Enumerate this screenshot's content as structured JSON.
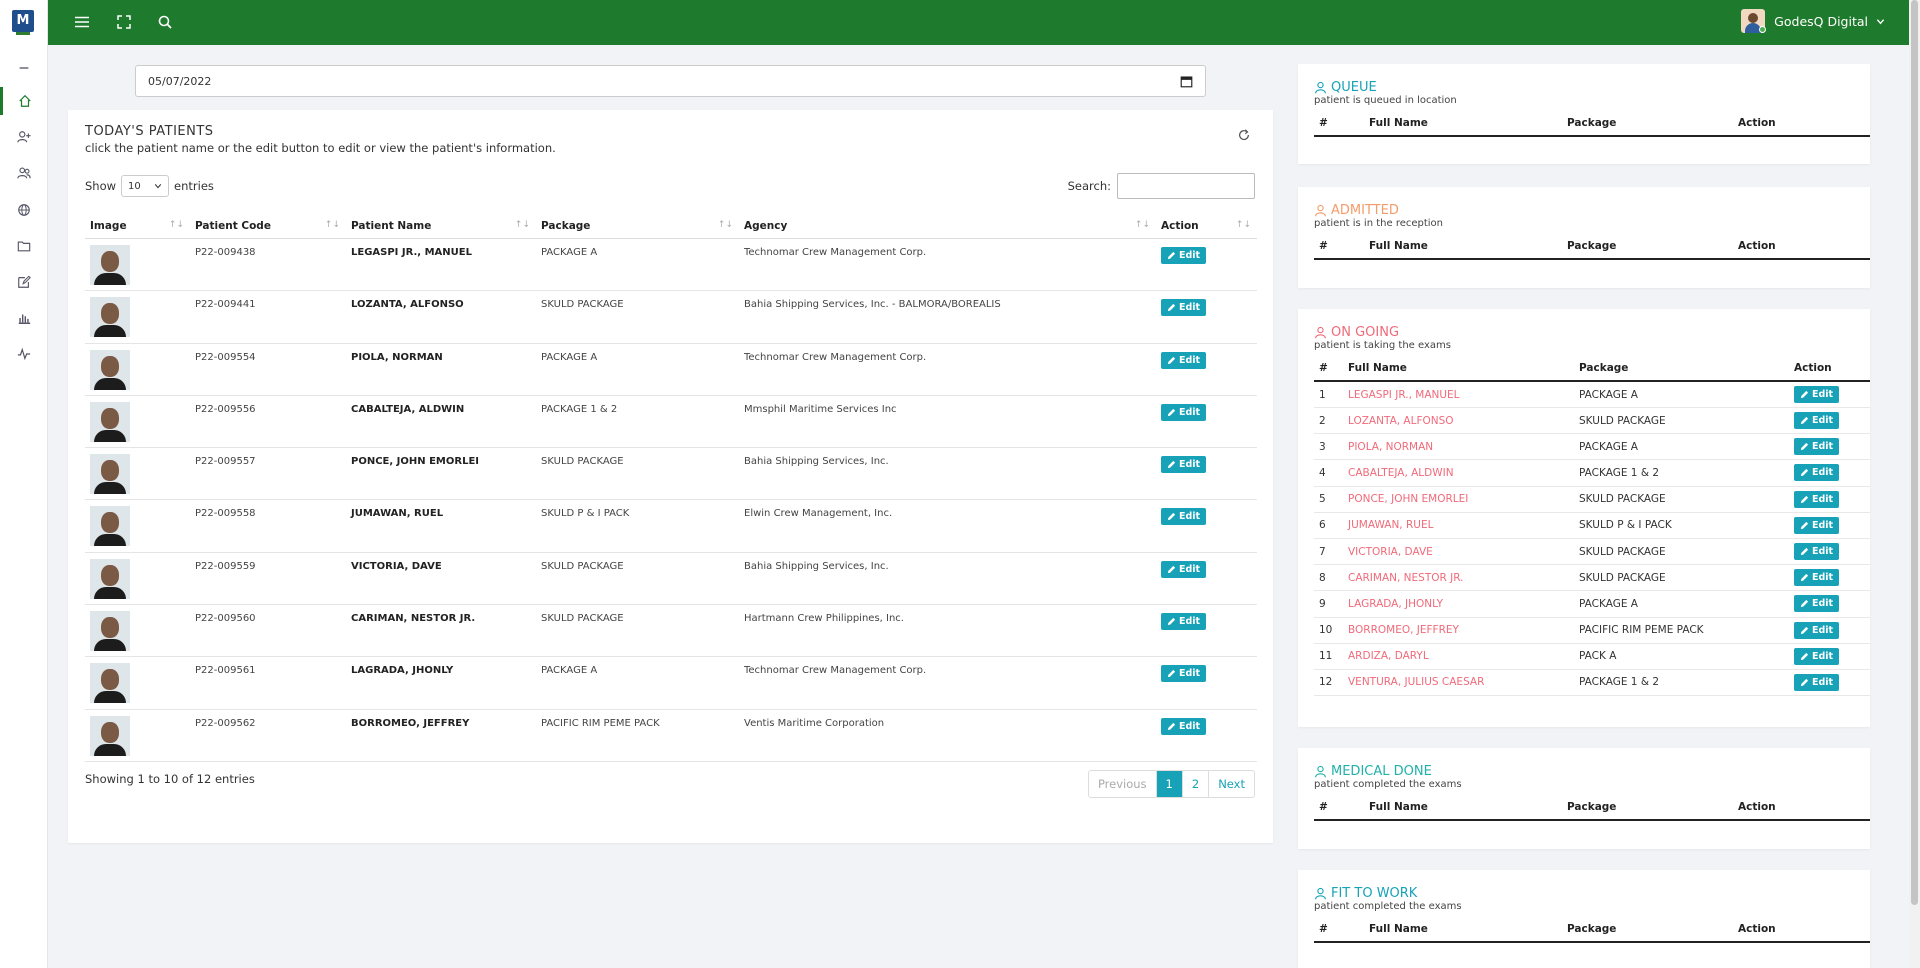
{
  "app": {
    "logo_text": "M",
    "user_name": "GodesQ Digital"
  },
  "colors": {
    "brand_green": "#1e7a2c",
    "accent_teal": "#17a2b8",
    "ongoing_pink": "#f06a7a",
    "admitted_orange": "#f39c6b"
  },
  "sidebar": {
    "items": [
      {
        "icon": "minus-icon"
      },
      {
        "icon": "home-icon"
      },
      {
        "icon": "add-user-icon"
      },
      {
        "icon": "users-icon"
      },
      {
        "icon": "globe-icon"
      },
      {
        "icon": "folder-icon"
      },
      {
        "icon": "edit-icon"
      },
      {
        "icon": "bar-chart-icon"
      },
      {
        "icon": "activity-icon"
      }
    ]
  },
  "date_filter": {
    "value": "05/07/2022"
  },
  "todays_patients": {
    "title": "TODAY'S PATIENTS",
    "subtitle": "click the patient name or the edit button to edit or view the patient's information.",
    "show_label": "Show",
    "entries_value": "10",
    "entries_label": "entries",
    "search_label": "Search:",
    "columns": [
      "Image",
      "Patient Code",
      "Patient Name",
      "Package",
      "Agency",
      "Action"
    ],
    "edit_label": "Edit",
    "rows": [
      {
        "code": "P22-009438",
        "name": "LEGASPI JR., MANUEL",
        "package": "PACKAGE A",
        "agency": "Technomar Crew Management Corp."
      },
      {
        "code": "P22-009441",
        "name": "LOZANTA, ALFONSO",
        "package": "SKULD PACKAGE",
        "agency": "Bahia Shipping Services, Inc. - BALMORA/BOREALIS"
      },
      {
        "code": "P22-009554",
        "name": "PIOLA, NORMAN",
        "package": "PACKAGE A",
        "agency": "Technomar Crew Management Corp."
      },
      {
        "code": "P22-009556",
        "name": "CABALTEJA, ALDWIN",
        "package": "PACKAGE 1 & 2",
        "agency": "Mmsphil Maritime Services Inc"
      },
      {
        "code": "P22-009557",
        "name": "PONCE, JOHN EMORLEI",
        "package": "SKULD PACKAGE",
        "agency": "Bahia Shipping Services, Inc."
      },
      {
        "code": "P22-009558",
        "name": "JUMAWAN, RUEL",
        "package": "SKULD P & I PACK",
        "agency": "Elwin Crew Management, Inc."
      },
      {
        "code": "P22-009559",
        "name": "VICTORIA, DAVE",
        "package": "SKULD PACKAGE",
        "agency": "Bahia Shipping Services, Inc."
      },
      {
        "code": "P22-009560",
        "name": "CARIMAN, NESTOR JR.",
        "package": "SKULD PACKAGE",
        "agency": "Hartmann Crew Philippines, Inc."
      },
      {
        "code": "P22-009561",
        "name": "LAGRADA, JHONLY",
        "package": "PACKAGE A",
        "agency": "Technomar Crew Management Corp."
      },
      {
        "code": "P22-009562",
        "name": "BORROMEO, JEFFREY",
        "package": "PACIFIC RIM PEME PACK",
        "agency": "Ventis Maritime Corporation"
      }
    ],
    "showing_text": "Showing 1 to 10 of 12 entries",
    "pagination": {
      "previous": "Previous",
      "pages": [
        "1",
        "2"
      ],
      "next": "Next"
    }
  },
  "panels": {
    "queue": {
      "title": "QUEUE",
      "subtitle": "patient is queued in location",
      "columns": [
        "#",
        "Full Name",
        "Package",
        "Action"
      ]
    },
    "admitted": {
      "title": "ADMITTED",
      "subtitle": "patient is in the reception",
      "columns": [
        "#",
        "Full Name",
        "Package",
        "Action"
      ]
    },
    "ongoing": {
      "title": "ON GOING",
      "subtitle": "patient is taking the exams",
      "columns": [
        "#",
        "Full Name",
        "Package",
        "Action"
      ],
      "rows": [
        {
          "num": "1",
          "name": "LEGASPI JR., MANUEL",
          "package": "PACKAGE A"
        },
        {
          "num": "2",
          "name": "LOZANTA, ALFONSO",
          "package": "SKULD PACKAGE"
        },
        {
          "num": "3",
          "name": "PIOLA, NORMAN",
          "package": "PACKAGE A"
        },
        {
          "num": "4",
          "name": "CABALTEJA, ALDWIN",
          "package": "PACKAGE 1 & 2"
        },
        {
          "num": "5",
          "name": "PONCE, JOHN EMORLEI",
          "package": "SKULD PACKAGE"
        },
        {
          "num": "6",
          "name": "JUMAWAN, RUEL",
          "package": "SKULD P & I PACK"
        },
        {
          "num": "7",
          "name": "VICTORIA, DAVE",
          "package": "SKULD PACKAGE"
        },
        {
          "num": "8",
          "name": "CARIMAN, NESTOR JR.",
          "package": "SKULD PACKAGE"
        },
        {
          "num": "9",
          "name": "LAGRADA, JHONLY",
          "package": "PACKAGE A"
        },
        {
          "num": "10",
          "name": "BORROMEO, JEFFREY",
          "package": "PACIFIC RIM PEME PACK"
        },
        {
          "num": "11",
          "name": "ARDIZA, DARYL",
          "package": "PACK A"
        },
        {
          "num": "12",
          "name": "VENTURA, JULIUS CAESAR",
          "package": "PACKAGE 1 & 2"
        }
      ]
    },
    "medical_done": {
      "title": "MEDICAL DONE",
      "subtitle": "patient completed the exams",
      "columns": [
        "#",
        "Full Name",
        "Package",
        "Action"
      ]
    },
    "fit_to_work": {
      "title": "FIT TO WORK",
      "subtitle": "patient completed the exams",
      "columns": [
        "#",
        "Full Name",
        "Package",
        "Action"
      ]
    }
  }
}
